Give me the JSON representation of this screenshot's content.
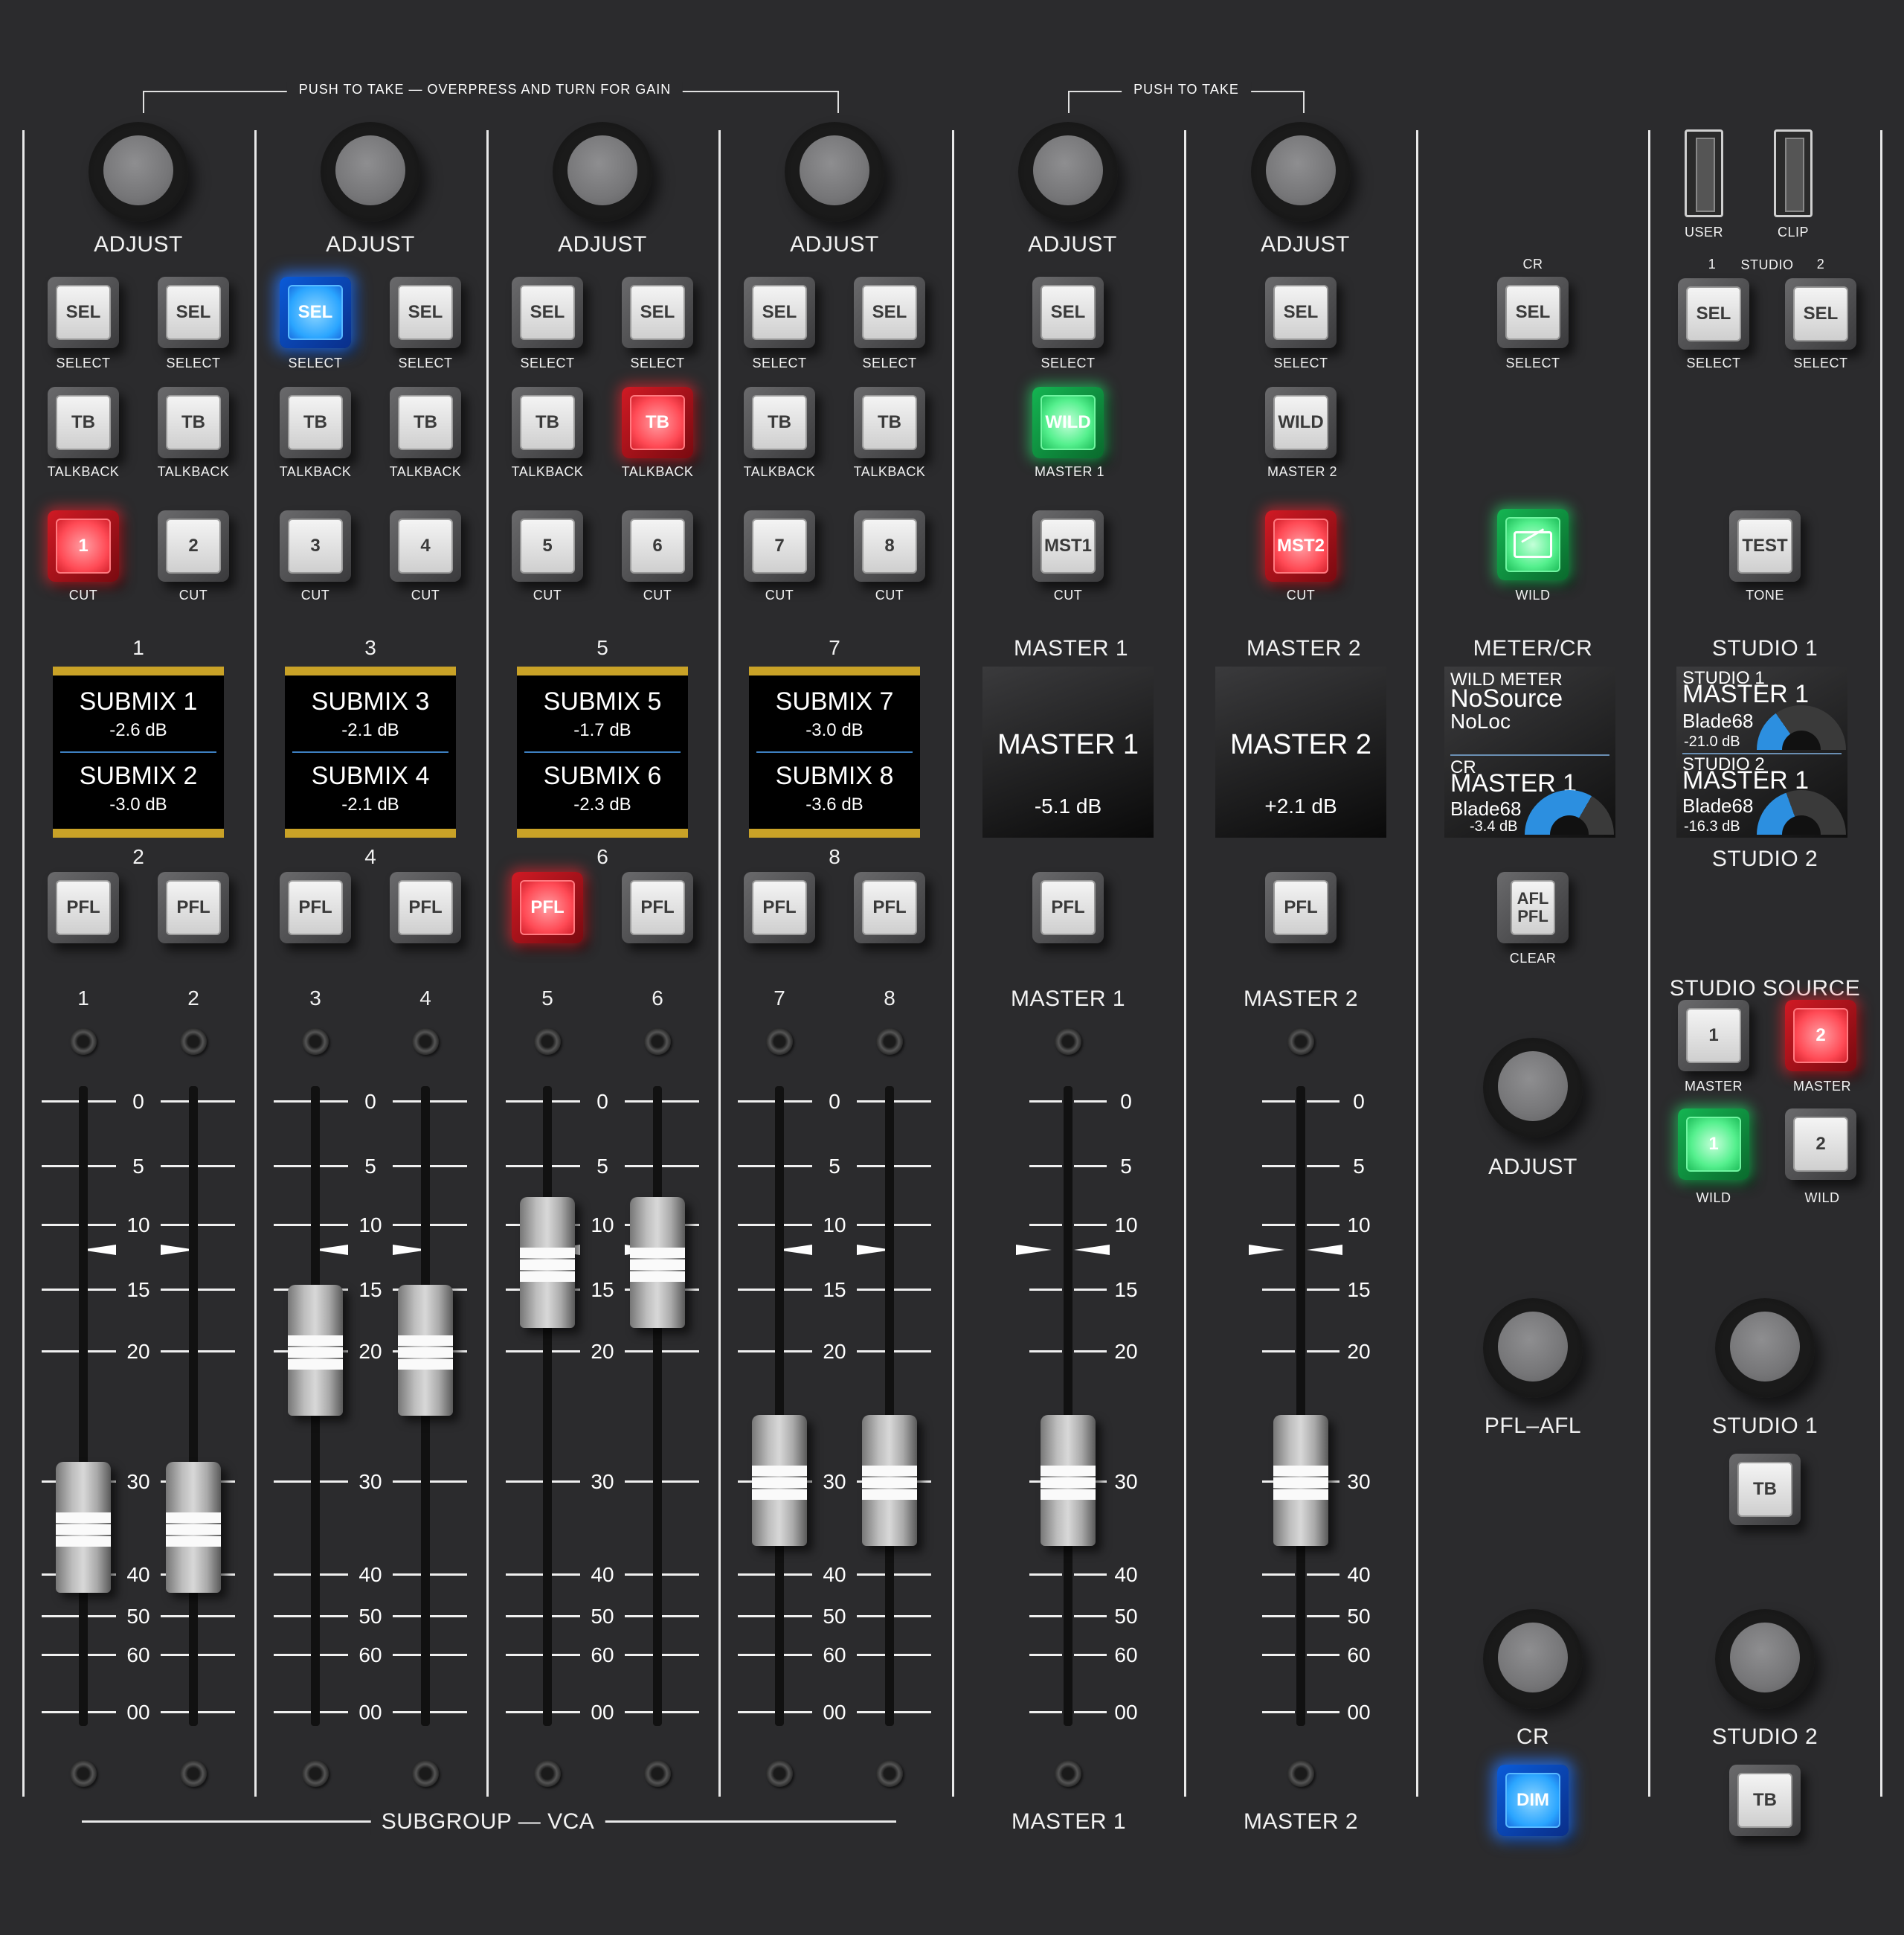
{
  "headers": {
    "gain_bracket": "PUSH TO TAKE  —  OVERPRESS AND TURN FOR GAIN",
    "master_bracket": "PUSH TO TAKE"
  },
  "knob_label": "ADJUST",
  "button_labels": {
    "sel": "SEL",
    "select": "SELECT",
    "tb": "TB",
    "talkback": "TALKBACK",
    "cut": "CUT",
    "pfl": "PFL",
    "wild": "WILD",
    "mst1": "MST1",
    "mst2": "MST2",
    "master1_small": "MASTER 1",
    "master2_small": "MASTER 2",
    "test": "TEST",
    "tone": "TONE",
    "afl_pfl": "AFL PFL",
    "clear": "CLEAR",
    "dim": "DIM",
    "master_small": "MASTER",
    "wild_small": "WILD"
  },
  "channels": [
    {
      "top": "1",
      "bottom": "2",
      "cut": [
        "1",
        "2"
      ],
      "fader_nums": [
        "1",
        "2"
      ],
      "display": {
        "a_name": "SUBMIX 1",
        "a_val": "-2.6 dB",
        "b_name": "SUBMIX 2",
        "b_val": "-3.0 dB"
      }
    },
    {
      "top": "3",
      "bottom": "4",
      "cut": [
        "3",
        "4"
      ],
      "fader_nums": [
        "3",
        "4"
      ],
      "display": {
        "a_name": "SUBMIX 3",
        "a_val": "-2.1 dB",
        "b_name": "SUBMIX 4",
        "b_val": "-2.1 dB"
      }
    },
    {
      "top": "5",
      "bottom": "6",
      "cut": [
        "5",
        "6"
      ],
      "fader_nums": [
        "5",
        "6"
      ],
      "display": {
        "a_name": "SUBMIX 5",
        "a_val": "-1.7 dB",
        "b_name": "SUBMIX 6",
        "b_val": "-2.3 dB"
      }
    },
    {
      "top": "7",
      "bottom": "8",
      "cut": [
        "7",
        "8"
      ],
      "fader_nums": [
        "7",
        "8"
      ],
      "display": {
        "a_name": "SUBMIX 7",
        "a_val": "-3.0 dB",
        "b_name": "SUBMIX 8",
        "b_val": "-3.6 dB"
      }
    }
  ],
  "masters": [
    {
      "title": "MASTER 1",
      "display_name": "MASTER 1",
      "display_val": "-5.1 dB",
      "label": "MASTER 1"
    },
    {
      "title": "MASTER 2",
      "display_name": "MASTER 2",
      "display_val": "+2.1 dB",
      "label": "MASTER 2"
    }
  ],
  "fader_scale": [
    "0",
    "5",
    "10",
    "15",
    "20",
    "30",
    "40",
    "50",
    "60",
    "00"
  ],
  "fader_levels_db": {
    "ch1": 35,
    "ch2": 35,
    "ch3": 20,
    "ch4": 20,
    "ch5": 13,
    "ch6": 13,
    "ch7": 30,
    "ch8": 30,
    "master1": 30,
    "master2": 30
  },
  "meter_cr": {
    "title": "METER/CR",
    "cr_small": "CR",
    "wild_meter": "WILD METER",
    "source": "NoSource",
    "loc": "NoLoc",
    "cr_label": "CR",
    "cr_master": "MASTER 1",
    "cr_device": "Blade68",
    "cr_val": "-3.4 dB",
    "adjust": "ADJUST",
    "pfl_afl": "PFL–AFL",
    "cr_knob": "CR"
  },
  "studio": {
    "usb_user": "USER",
    "usb_clip": "CLIP",
    "num1": "1",
    "studio_small": "STUDIO",
    "num2": "2",
    "title1": "STUDIO 1",
    "title2": "STUDIO 2",
    "d1_studio": "STUDIO 1",
    "d1_master": "MASTER 1",
    "d1_device": "Blade68",
    "d1_val": "-21.0 dB",
    "d2_studio": "STUDIO 2",
    "d2_master": "MASTER 1",
    "d2_device": "Blade68",
    "d2_val": "-16.3 dB",
    "source_title": "STUDIO SOURCE",
    "src": [
      "1",
      "2",
      "1",
      "2"
    ],
    "knob1": "STUDIO 1",
    "knob2": "STUDIO 2"
  },
  "footer": {
    "subgroup": "SUBGROUP — VCA",
    "master1": "MASTER 1",
    "master2": "MASTER 2"
  },
  "lit_colors": {
    "blue": "#2aa5ff",
    "red": "#ff4a55",
    "green": "#55f08e",
    "gold": "#c9a227"
  },
  "lit_states": {
    "sel_ch3": "blue",
    "tb_ch6": "red",
    "cut_ch1": "red",
    "pfl_ch5": "red",
    "wild_master1": "green",
    "mst2_cut": "red",
    "meter_wild": "green",
    "dim": "blue",
    "source_master2": "red",
    "source_wild1": "green"
  }
}
